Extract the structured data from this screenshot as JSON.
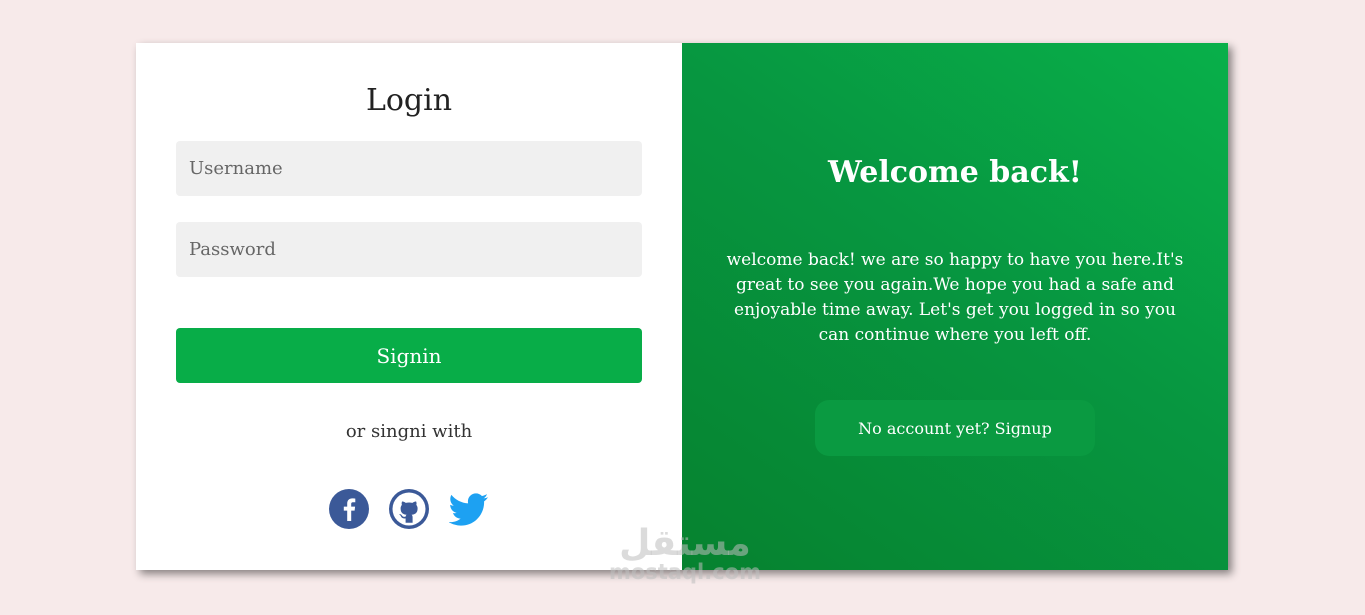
{
  "login": {
    "title": "Login",
    "username_placeholder": "Username",
    "password_placeholder": "Password",
    "signin_label": "Signin",
    "or_text": "or singni with",
    "social_icons": [
      "facebook-icon",
      "github-icon",
      "twitter-icon"
    ]
  },
  "welcome": {
    "title": "Welcome back!",
    "message": "welcome back! we are so happy to have you here.It's great to see you again.We hope you had a safe and enjoyable time away. Let's get you logged in so you can continue where you left off.",
    "signup_label": "No account yet? Signup"
  },
  "watermark": {
    "arabic": "مستقل",
    "latin": "mostaql.com"
  },
  "colors": {
    "page_bg": "#f7eaea",
    "accent_green": "#08ad48",
    "panel_green_light": "#08b04a",
    "panel_green_dark": "#06822f",
    "field_bg": "#f0f0f0",
    "facebook": "#3b5998",
    "github": "#3b5998",
    "twitter": "#1da1f2"
  }
}
